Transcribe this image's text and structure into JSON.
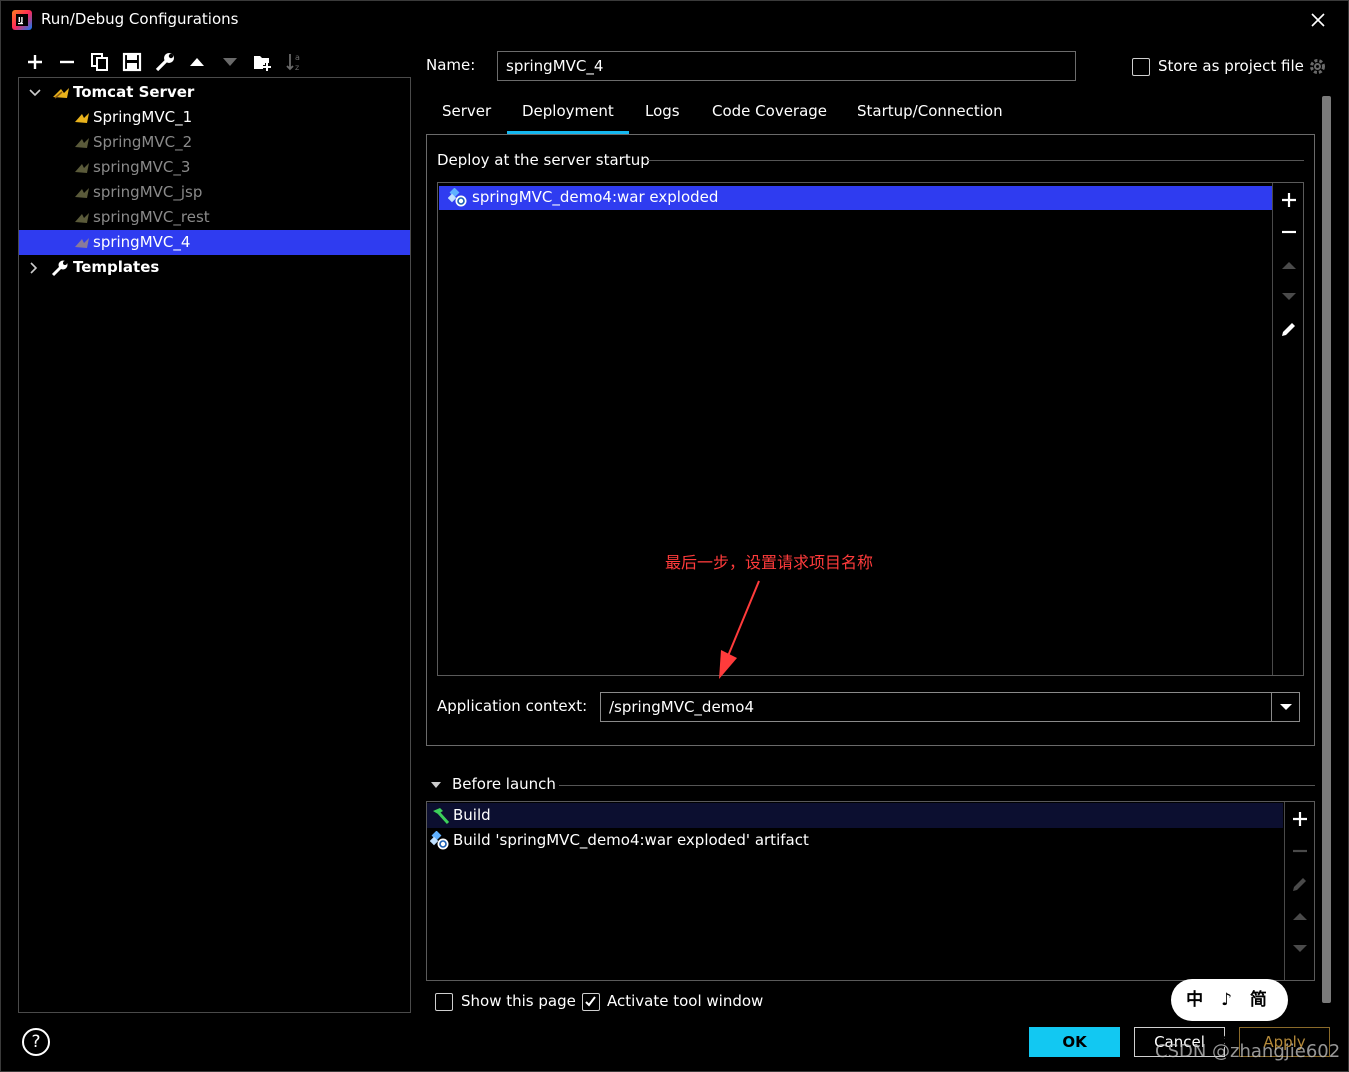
{
  "window": {
    "title": "Run/Debug Configurations"
  },
  "toolbar": {
    "icons": [
      "add-icon",
      "remove-icon",
      "copy-icon",
      "save-icon",
      "wrench-icon",
      "move-up-icon",
      "move-down-icon",
      "new-folder-icon",
      "sort-icon"
    ]
  },
  "tree": {
    "group": "Tomcat Server",
    "items": [
      {
        "label": "SpringMVC_1",
        "style": "normal"
      },
      {
        "label": "SpringMVC_2",
        "style": "muted"
      },
      {
        "label": "springMVC_3",
        "style": "muted"
      },
      {
        "label": "springMVC_jsp",
        "style": "muted"
      },
      {
        "label": "springMVC_rest",
        "style": "muted"
      },
      {
        "label": "springMVC_4",
        "style": "selected"
      }
    ],
    "templates": "Templates"
  },
  "name": {
    "label": "Name:",
    "value": "springMVC_4"
  },
  "store": {
    "label": "Store as project file",
    "checked": false
  },
  "tabs": [
    {
      "label": "Server",
      "active": false
    },
    {
      "label": "Deployment",
      "active": true
    },
    {
      "label": "Logs",
      "active": false
    },
    {
      "label": "Code Coverage",
      "active": false
    },
    {
      "label": "Startup/Connection",
      "active": false
    }
  ],
  "deploy": {
    "legend": "Deploy at the server startup",
    "items": [
      "springMVC_demo4:war exploded"
    ]
  },
  "context": {
    "label": "Application context:",
    "value": "/springMVC_demo4"
  },
  "annotation": "最后一步，设置请求项目名称",
  "before_launch": {
    "label": "Before launch",
    "items": [
      {
        "label": "Build",
        "icon": "hammer-icon"
      },
      {
        "label": "Build 'springMVC_demo4:war exploded' artifact",
        "icon": "artifact-icon"
      }
    ]
  },
  "options": {
    "show_page": {
      "label": "Show this page",
      "checked": false
    },
    "activate": {
      "label": "Activate tool window",
      "checked": true
    }
  },
  "buttons": {
    "ok": "OK",
    "cancel": "Cancel",
    "apply": "Apply",
    "help": "?"
  },
  "overlay": {
    "ime": "中 ♪ 简 ♞",
    "watermark": "CSDN @zhangjie602"
  },
  "colors": {
    "selection": "#2f3cf0",
    "accent": "#14b8f0",
    "ok": "#12c8f2",
    "annotation": "#ff3b3b"
  }
}
